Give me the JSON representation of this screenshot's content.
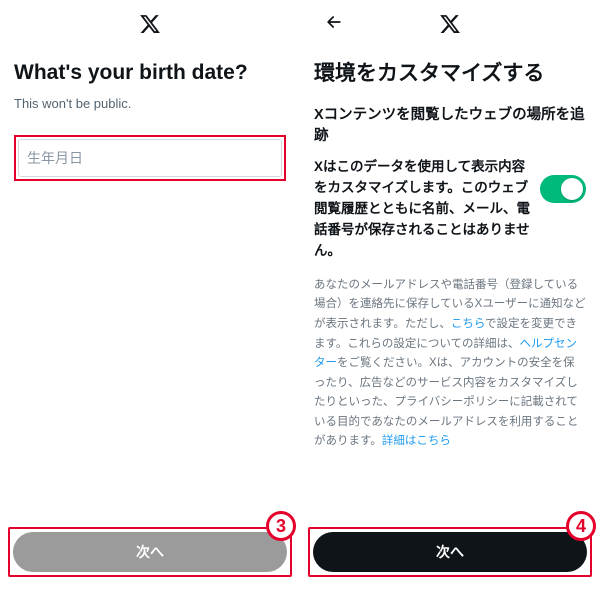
{
  "left": {
    "title": "What's your birth date?",
    "subtitle": "This won't be public.",
    "placeholder": "生年月日",
    "next_label": "次へ",
    "badge": "3"
  },
  "right": {
    "title": "環境をカスタマイズする",
    "section_title": "Xコンテンツを閲覧したウェブの場所を追跡",
    "toggle_text": "Xはこのデータを使用して表示内容をカスタマイズします。このウェブ閲覧履歴とともに名前、メール、電話番号が保存されることはありません。",
    "fine_1a": "あなたのメールアドレスや電話番号（登録している場合）を連絡先に保存しているXユーザーに通知などが表示されます。ただし、",
    "fine_link1": "こちら",
    "fine_1b": "で設定を変更できます。これらの設定についての詳細は、",
    "fine_link2": "ヘルプセンター",
    "fine_1c": "をご覧ください。Xは、アカウントの安全を保ったり、広告などのサービス内容をカスタマイズしたりといった、プライバシーポリシーに記載されている目的であなたのメールアドレスを利用することがあります。",
    "fine_link3": "詳細はこちら",
    "next_label": "次へ",
    "badge": "4",
    "toggle_on": true
  },
  "icons": {
    "x_logo": "x-logo-icon",
    "back": "arrow-left-icon"
  }
}
